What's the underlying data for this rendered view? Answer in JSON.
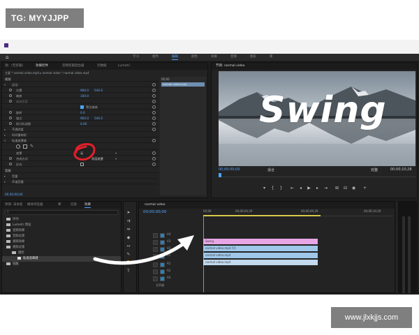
{
  "watermark_top": "TG: MYYJJPP",
  "watermark_bottom": "www.jlxkjjs.com",
  "workspace_tabs": [
    "学习",
    "组件",
    "编辑",
    "颜色",
    "效果",
    "音频",
    "图形",
    "库"
  ],
  "effect_controls": {
    "tabs": [
      "源：(无剪辑)",
      "效果控件",
      "音频剪辑混合器",
      "元数据",
      "Lumetri"
    ],
    "breadcrumb": "主要 * normal video.mp4  ▸  normal video * normal video.mp4",
    "section_video": "视频",
    "rows": [
      {
        "name": "运动",
        "indent": 1
      },
      {
        "name": "位置",
        "v1": "960.0",
        "v2": "540.0",
        "indent": 2
      },
      {
        "name": "缩放",
        "v1": "100.0",
        "indent": 2
      },
      {
        "name": "缩放宽度",
        "v1": "",
        "indent": 2
      },
      {
        "name": "等比缩放",
        "v1": "",
        "indent": 3,
        "check": true
      },
      {
        "name": "旋转",
        "v1": "0.0",
        "indent": 2
      },
      {
        "name": "锚点",
        "v1": "960.0",
        "v2": "540.0",
        "indent": 2
      },
      {
        "name": "防闪烁滤镜",
        "v1": "0.00",
        "indent": 2
      },
      {
        "name": "不透明度",
        "indent": 1
      },
      {
        "name": "时间重映射",
        "indent": 1
      },
      {
        "name": "轨道遮罩键",
        "indent": 1
      },
      {
        "name": "遮罩",
        "v1": "无",
        "indent": 2
      },
      {
        "name": "合成方式",
        "v1": "亮度遮罩",
        "indent": 2
      },
      {
        "name": "反向",
        "indent": 2
      }
    ],
    "section_audio": "音频",
    "audio_rows": [
      "音量",
      "声道音量"
    ],
    "timecode": "00;00;00;00",
    "mini_timeline_time": "00;00",
    "mini_timeline_clip": "normal video.mp4"
  },
  "program_monitor": {
    "tab": "节目: normal video",
    "title_text": "Swing",
    "timecode_current": "00;00;00;00",
    "fit": "适合",
    "quality": "完整",
    "timecode_total": "00;00;10;28"
  },
  "project_panel": {
    "tabs": [
      "项目: 未命名",
      "媒体浏览器",
      "库",
      "信息",
      "效果"
    ],
    "items": [
      "序列",
      "Lumetri 预设",
      "音频效果",
      "音频过渡",
      "视频效果",
      "视频过渡",
      "键控",
      "轨道遮罩键",
      "扭曲"
    ],
    "selected_item": "轨道遮罩键"
  },
  "timeline": {
    "tab": "normal video",
    "timecode": "00;00;00;00",
    "ruler": [
      "00;00",
      "00;00;04;29",
      "00;00;09;29",
      "00;00;14;29"
    ],
    "tracks": [
      "V4",
      "V3",
      "V2",
      "V1",
      "A1",
      "A2",
      "A3",
      "主声道"
    ],
    "clips": [
      {
        "label": "Swing",
        "color": "#e8a6e6"
      },
      {
        "label": "normal video.mp4 [V]",
        "color": "#9ec7ea"
      },
      {
        "label": "normal video.mp4",
        "color": "#9ec7ea"
      },
      {
        "label": "normal video.mp4",
        "color": "#c2d9ee"
      }
    ]
  },
  "colors": {
    "accent": "#4aa3ff",
    "annotation_circle": "#e0202a",
    "timecode": "#5aa9ff"
  }
}
